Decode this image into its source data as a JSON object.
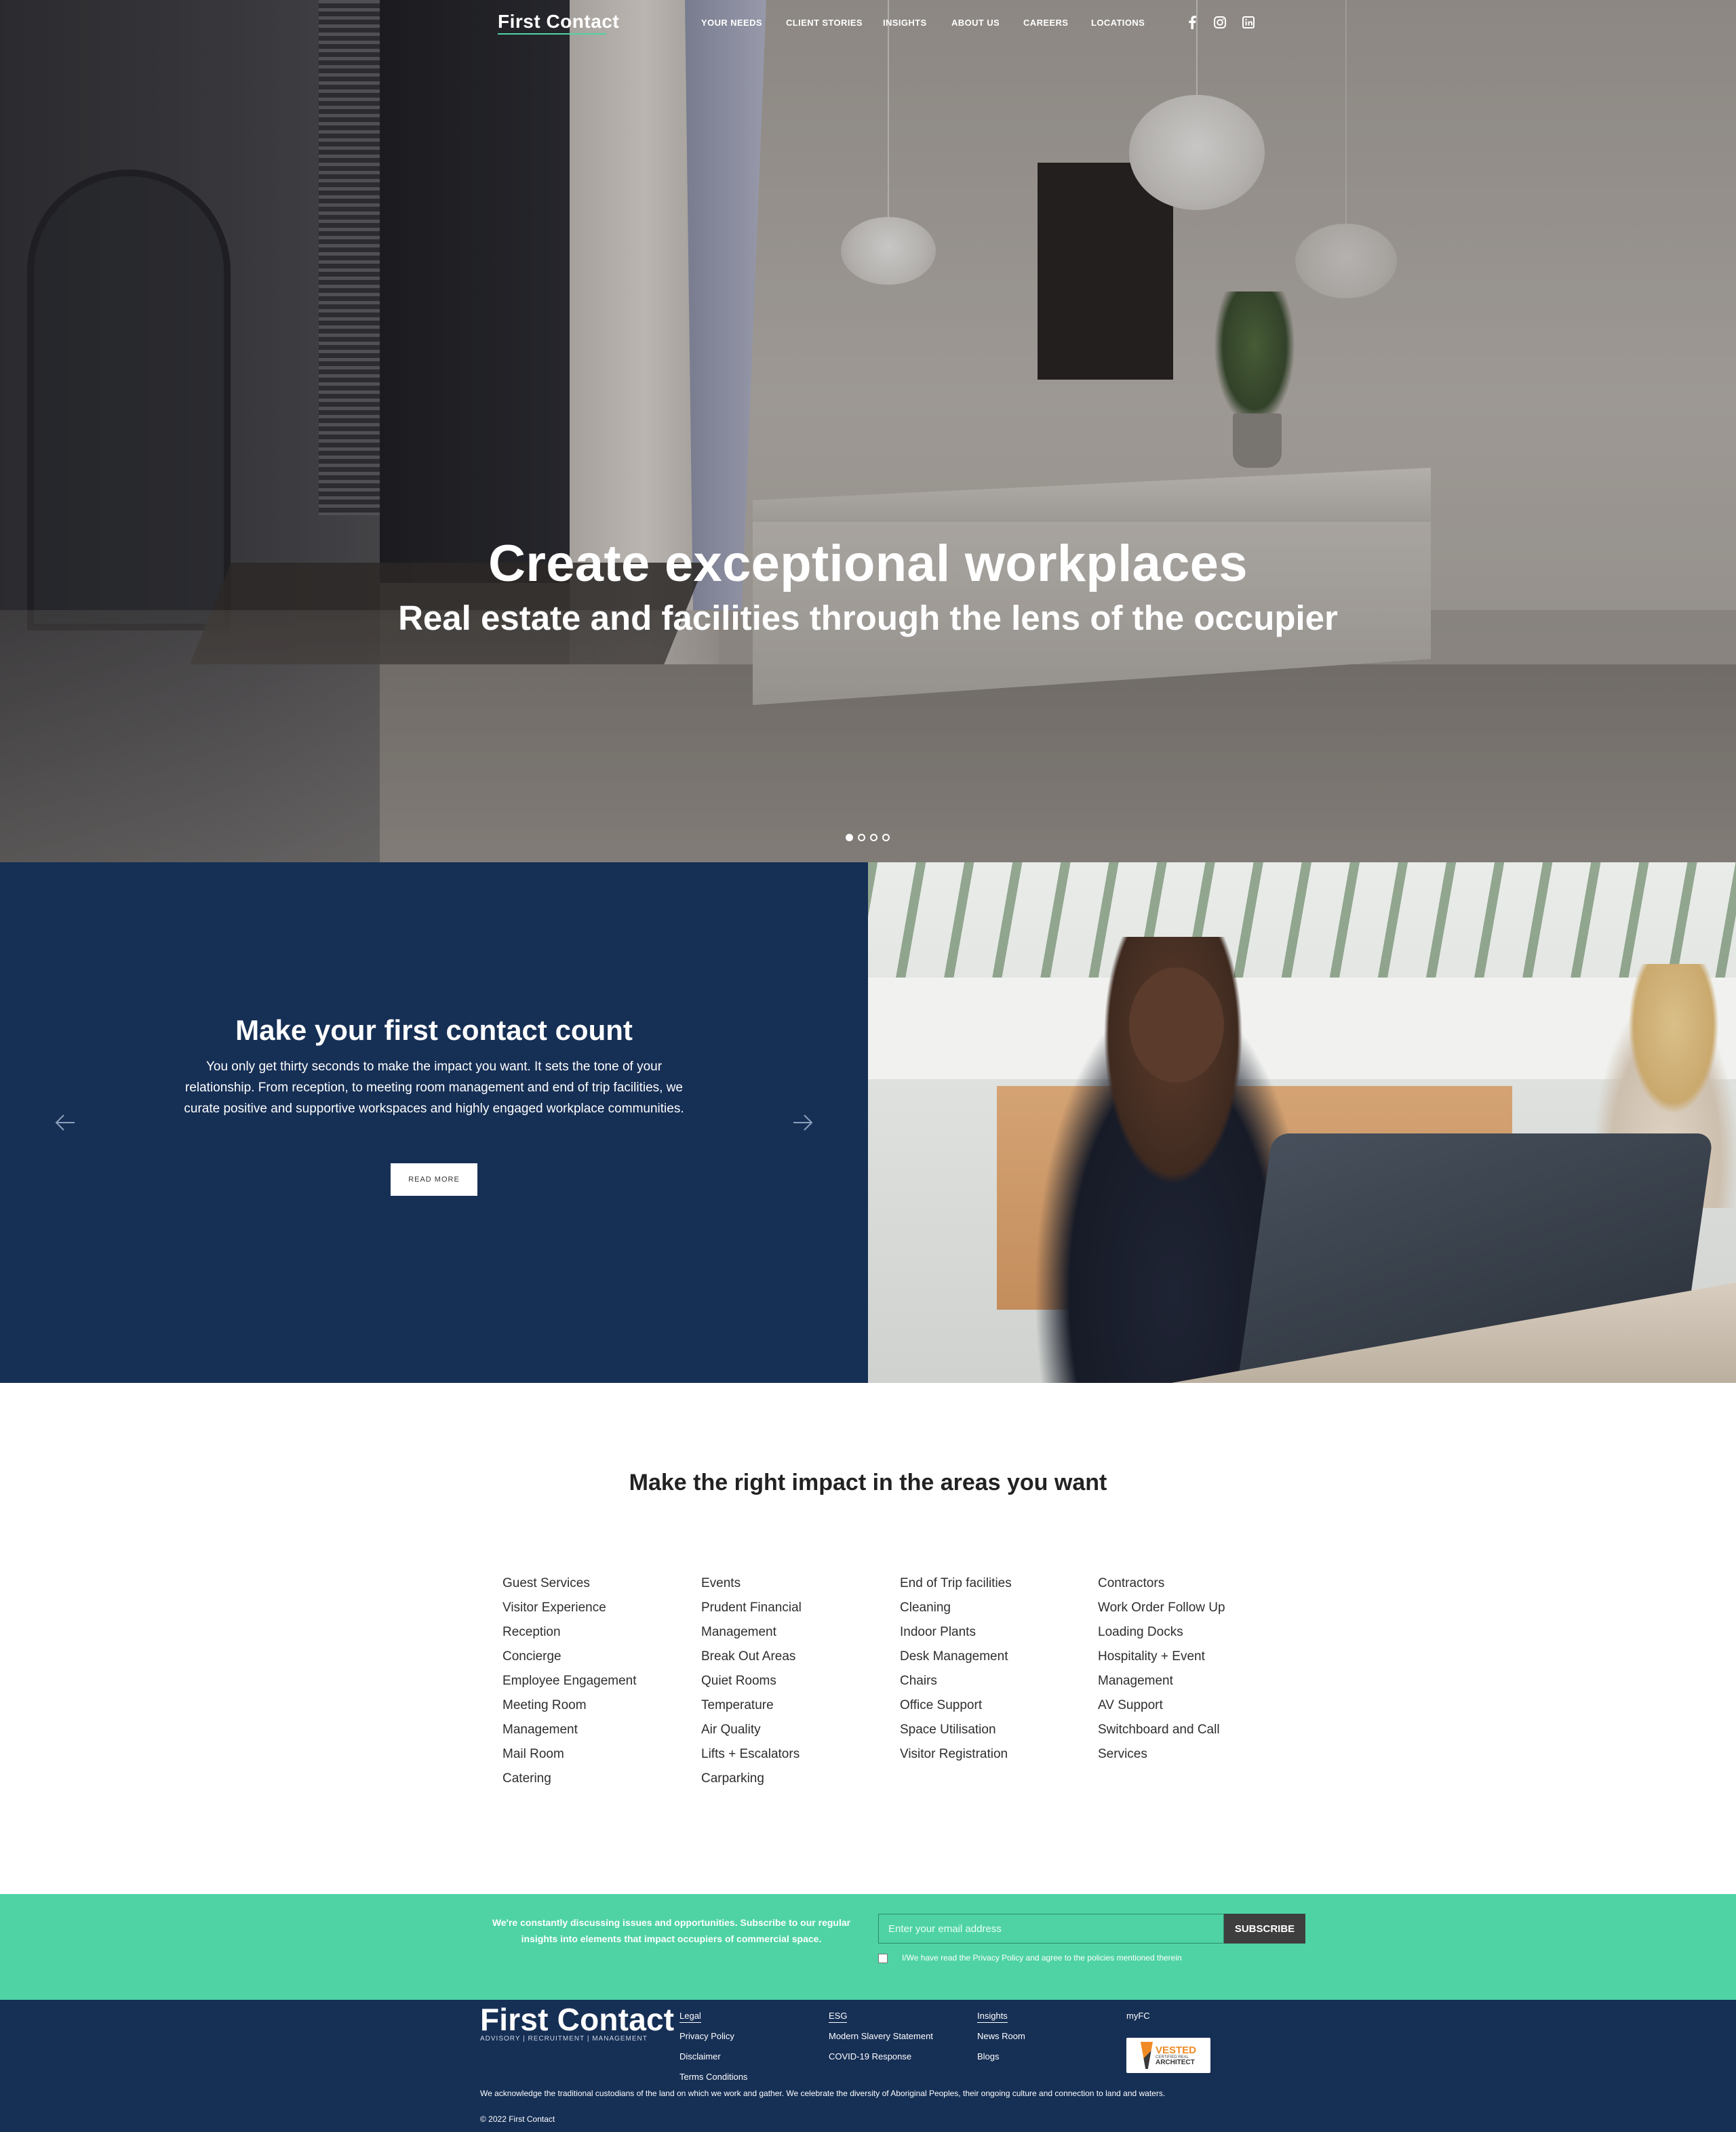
{
  "nav": {
    "logo": "First Contact",
    "items": [
      "YOUR NEEDS",
      "CLIENT STORIES",
      "INSIGHTS",
      "ABOUT US",
      "CAREERS",
      "LOCATIONS"
    ],
    "social": [
      "facebook-icon",
      "instagram-icon",
      "linkedin-icon"
    ]
  },
  "hero": {
    "title": "Create exceptional workplaces",
    "subtitle": "Real estate and facilities through the lens of the occupier",
    "slides_total": 4,
    "active_slide": 1
  },
  "slider": {
    "title": "Make your first contact count",
    "body": "You only get thirty seconds to make the impact you want. It sets the tone of your relationship. From reception, to meeting room management and end of trip facilities, we curate positive and supportive workspaces and highly engaged workplace communities.",
    "button": "READ MORE"
  },
  "areas": {
    "title": "Make the right impact in the areas you want",
    "columns": [
      [
        "Guest Services",
        "Visitor Experience",
        "Reception",
        "Concierge",
        "Employee Engagement",
        "Meeting Room",
        "Management",
        "Mail Room",
        "Catering"
      ],
      [
        "Events",
        "Prudent Financial",
        "Management",
        "Break Out Areas",
        "Quiet Rooms",
        "Temperature",
        "Air Quality",
        "Lifts + Escalators",
        "Carparking"
      ],
      [
        "End of Trip facilities",
        "Cleaning",
        "Indoor Plants",
        "Desk Management",
        "Chairs",
        "Office Support",
        "Space Utilisation",
        "Visitor Registration"
      ],
      [
        "Contractors",
        "Work Order Follow Up",
        "Loading Docks",
        "Hospitality + Event",
        "Management",
        "AV Support",
        "Switchboard and Call",
        "Services"
      ]
    ]
  },
  "subscribe": {
    "text": "We're constantly discussing issues and opportunities. Subscribe to our regular insights into elements that impact occupiers of commercial space.",
    "placeholder": "Enter your email address",
    "button": "SUBSCRIBE",
    "consent": "I/We have read the Privacy Policy and agree to the policies mentioned therein"
  },
  "footer": {
    "logo": "First Contact",
    "tagline": "ADVISORY   |   RECRUITMENT   |   MANAGEMENT",
    "col1": [
      "Legal",
      "Privacy Policy",
      "Disclaimer",
      "Terms Conditions"
    ],
    "col2": [
      "ESG",
      "Modern Slavery Statement",
      "COVID-19 Response"
    ],
    "col3": [
      "Insights",
      "News Room",
      "Blogs"
    ],
    "col4": [
      "myFC"
    ],
    "badge": {
      "line1": "VESTED",
      "line2": "CERTIFIED REAL",
      "line3": "ARCHITECT"
    },
    "acknowledgement": "We acknowledge the traditional custodians of the land on which we work and gather. We celebrate the diversity of Aboriginal Peoples, their ongoing culture and connection to land and waters.",
    "copyright": "© 2022 First Contact"
  }
}
